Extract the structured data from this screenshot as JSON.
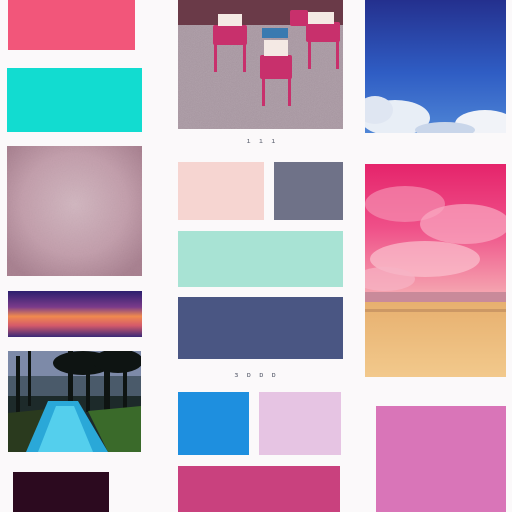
{
  "captions": {
    "top": "ı ı ı",
    "middle": "ɜ ɒ ɒ ɒ"
  },
  "swatches": [
    {
      "name": "coral-pink",
      "color": "#f2567a"
    },
    {
      "name": "turquoise",
      "color": "#12dcd0"
    },
    {
      "name": "blush",
      "color": "#f6d5d1"
    },
    {
      "name": "slate-gray",
      "color": "#6f7288"
    },
    {
      "name": "mint",
      "color": "#a8e3d4"
    },
    {
      "name": "denim",
      "color": "#4a5683"
    },
    {
      "name": "azure",
      "color": "#1e8fdf"
    },
    {
      "name": "lavender",
      "color": "#e6c4e3"
    },
    {
      "name": "orchid",
      "color": "#d975b8"
    },
    {
      "name": "magenta-rose",
      "color": "#c9417e"
    },
    {
      "name": "deep-plum",
      "color": "#2c0a1f"
    }
  ],
  "photos": [
    {
      "name": "pink-chairs-photo"
    },
    {
      "name": "blue-sky-clouds-photo"
    },
    {
      "name": "textured-paper-photo"
    },
    {
      "name": "sunset-gradient-photo"
    },
    {
      "name": "pink-sky-field-photo"
    },
    {
      "name": "forest-river-photo"
    }
  ]
}
